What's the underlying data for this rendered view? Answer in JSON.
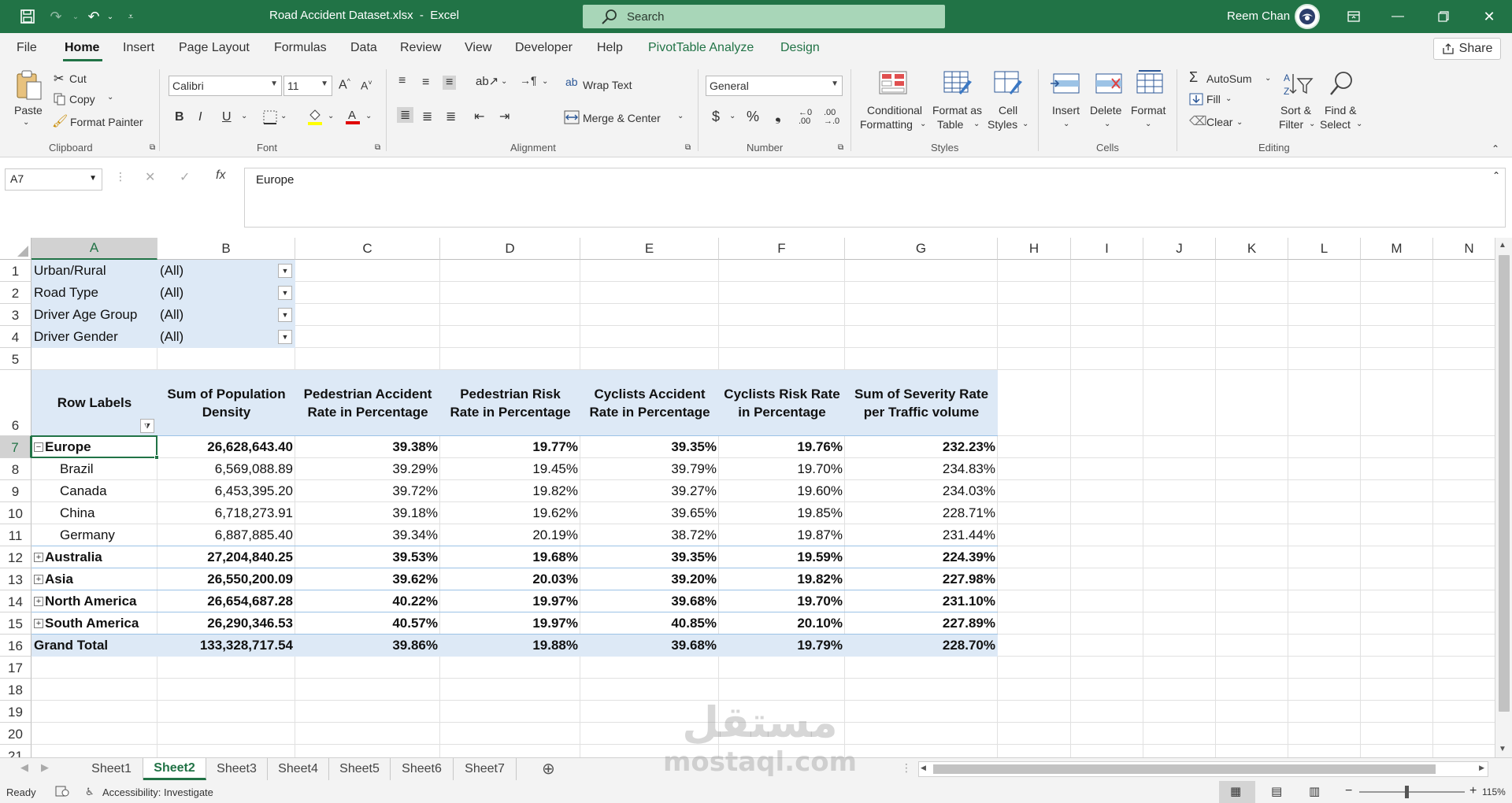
{
  "window": {
    "title": "Road Accident Dataset.xlsx  -  Excel",
    "search_placeholder": "Search",
    "user": "Reem Chan"
  },
  "menu": {
    "tabs": [
      "File",
      "Home",
      "Insert",
      "Page Layout",
      "Formulas",
      "Data",
      "Review",
      "View",
      "Developer",
      "Help",
      "PivotTable Analyze",
      "Design"
    ],
    "active": "Home",
    "share": "Share"
  },
  "ribbon": {
    "clipboard": {
      "paste": "Paste",
      "cut": "Cut",
      "copy": "Copy",
      "format_painter": "Format Painter",
      "label": "Clipboard"
    },
    "font": {
      "name": "Calibri",
      "size": "11",
      "label": "Font"
    },
    "alignment": {
      "wrap": "Wrap Text",
      "merge": "Merge & Center",
      "label": "Alignment"
    },
    "number": {
      "format": "General",
      "label": "Number"
    },
    "styles": {
      "cond1": "Conditional",
      "cond2": "Formatting",
      "fmt1": "Format as",
      "fmt2": "Table",
      "cell1": "Cell",
      "cell2": "Styles",
      "label": "Styles"
    },
    "cells": {
      "insert": "Insert",
      "delete": "Delete",
      "format": "Format",
      "label": "Cells"
    },
    "editing": {
      "autosum": "AutoSum",
      "fill": "Fill",
      "clear": "Clear",
      "sort1": "Sort &",
      "sort2": "Filter",
      "find1": "Find &",
      "find2": "Select",
      "label": "Editing"
    }
  },
  "formula_bar": {
    "name_box": "A7",
    "content": "Europe"
  },
  "grid": {
    "columns": [
      "A",
      "B",
      "C",
      "D",
      "E",
      "F",
      "G",
      "H",
      "I",
      "J",
      "K",
      "L",
      "M",
      "N"
    ],
    "rows": [
      "1",
      "2",
      "3",
      "4",
      "5",
      "6",
      "7",
      "8",
      "9",
      "10",
      "11",
      "12",
      "13",
      "14",
      "15",
      "16",
      "17",
      "18",
      "19",
      "20",
      "21"
    ],
    "filters": [
      {
        "label": "Urban/Rural",
        "value": "(All)"
      },
      {
        "label": "Road Type",
        "value": "(All)"
      },
      {
        "label": "Driver Age Group",
        "value": "(All)"
      },
      {
        "label": "Driver Gender",
        "value": "(All)"
      }
    ],
    "headers": {
      "a": "Row Labels",
      "b1": "Sum of Population",
      "b2": "Density",
      "c1": "Pedestrian Accident",
      "c2": "Rate in Percentage",
      "d1": "Pedestrian Risk",
      "d2": "Rate in Percentage",
      "e1": "Cyclists Accident",
      "e2": "Rate in Percentage",
      "f1": "Cyclists Risk Rate",
      "f2": "in Percentage",
      "g1": "Sum of Severity Rate",
      "g2": "per Traffic volume"
    },
    "data": [
      {
        "label": "Europe",
        "level": 0,
        "toggle": "−",
        "vals": [
          "26,628,643.40",
          "39.38%",
          "19.77%",
          "39.35%",
          "19.76%",
          "232.23%"
        ]
      },
      {
        "label": "Brazil",
        "level": 1,
        "toggle": "",
        "vals": [
          "6,569,088.89",
          "39.29%",
          "19.45%",
          "39.79%",
          "19.70%",
          "234.83%"
        ]
      },
      {
        "label": "Canada",
        "level": 1,
        "toggle": "",
        "vals": [
          "6,453,395.20",
          "39.72%",
          "19.82%",
          "39.27%",
          "19.60%",
          "234.03%"
        ]
      },
      {
        "label": "China",
        "level": 1,
        "toggle": "",
        "vals": [
          "6,718,273.91",
          "39.18%",
          "19.62%",
          "39.65%",
          "19.85%",
          "228.71%"
        ]
      },
      {
        "label": "Germany",
        "level": 1,
        "toggle": "",
        "vals": [
          "6,887,885.40",
          "39.34%",
          "20.19%",
          "38.72%",
          "19.87%",
          "231.44%"
        ]
      },
      {
        "label": "Australia",
        "level": 0,
        "toggle": "+",
        "vals": [
          "27,204,840.25",
          "39.53%",
          "19.68%",
          "39.35%",
          "19.59%",
          "224.39%"
        ]
      },
      {
        "label": "Asia",
        "level": 0,
        "toggle": "+",
        "vals": [
          "26,550,200.09",
          "39.62%",
          "20.03%",
          "39.20%",
          "19.82%",
          "227.98%"
        ]
      },
      {
        "label": "North America",
        "level": 0,
        "toggle": "+",
        "vals": [
          "26,654,687.28",
          "40.22%",
          "19.97%",
          "39.68%",
          "19.70%",
          "231.10%"
        ]
      },
      {
        "label": "South America",
        "level": 0,
        "toggle": "+",
        "vals": [
          "26,290,346.53",
          "40.57%",
          "19.97%",
          "40.85%",
          "20.10%",
          "227.89%"
        ]
      },
      {
        "label": "Grand Total",
        "level": -1,
        "toggle": "",
        "vals": [
          "133,328,717.54",
          "39.86%",
          "19.88%",
          "39.68%",
          "19.79%",
          "228.70%"
        ]
      }
    ]
  },
  "sheets": {
    "tabs": [
      "Sheet1",
      "Sheet2",
      "Sheet3",
      "Sheet4",
      "Sheet5",
      "Sheet6",
      "Sheet7"
    ],
    "active": "Sheet2"
  },
  "status": {
    "ready": "Ready",
    "accessibility": "Accessibility: Investigate",
    "zoom": "115%"
  },
  "watermark": {
    "arabic": "مستقل",
    "latin": "mostaql.com"
  }
}
